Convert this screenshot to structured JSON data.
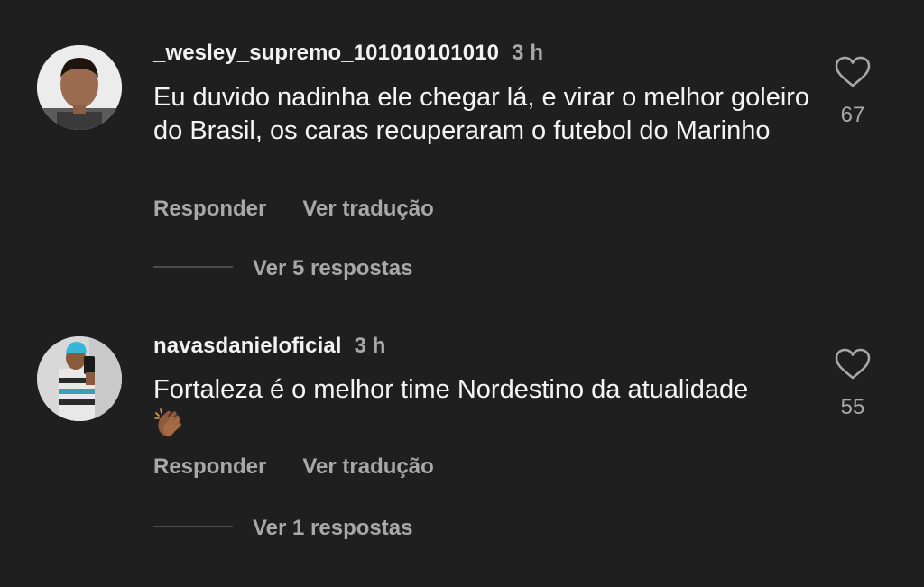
{
  "comments": [
    {
      "username": "_wesley_supremo_101010101010",
      "time": "3 h",
      "text": "Eu duvido nadinha ele chegar lá, e virar o melhor goleiro do Brasil, os caras recuperaram o futebol do Marinho",
      "likes": "67",
      "reply_label": "Responder",
      "translate_label": "Ver tradução",
      "view_replies": "Ver 5 respostas"
    },
    {
      "username": "navasdanieloficial",
      "time": "3 h",
      "text": "Fortaleza é o melhor time Nordestino da atualidade",
      "emoji": "👏🏾",
      "likes": "55",
      "reply_label": "Responder",
      "translate_label": "Ver tradução",
      "view_replies": "Ver 1 respostas"
    }
  ],
  "icons": {
    "like": "heart-outline-icon",
    "clap": "clapping-hands-icon"
  },
  "colors": {
    "background": "#1f1f1f",
    "primary_text": "#f2f2f2",
    "secondary_text": "#a8a8a8"
  }
}
